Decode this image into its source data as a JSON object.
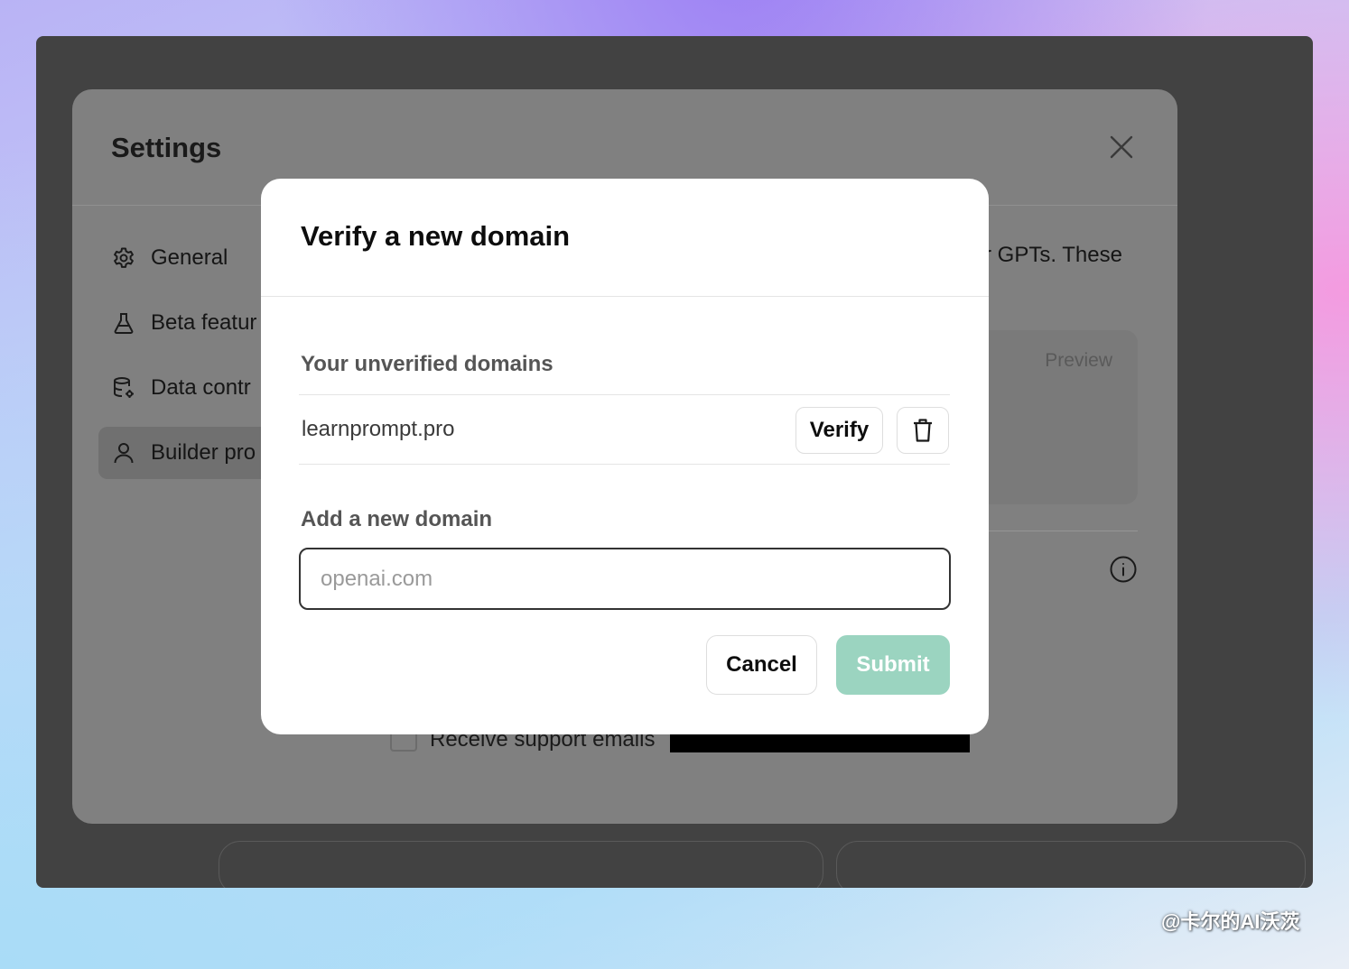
{
  "settings": {
    "title": "Settings",
    "nav": [
      {
        "label": "General",
        "icon": "gear-icon"
      },
      {
        "label": "Beta featur",
        "icon": "flask-icon"
      },
      {
        "label": "Data contr",
        "icon": "database-gear-icon"
      },
      {
        "label": "Builder pro",
        "icon": "user-icon",
        "active": true
      }
    ],
    "right_text": "r GPTs. These",
    "preview_label": "Preview",
    "support_label": "Receive support emails"
  },
  "modal": {
    "title": "Verify a new domain",
    "unverified_label": "Your unverified domains",
    "domains": [
      {
        "name": "learnprompt.pro",
        "verify_label": "Verify"
      }
    ],
    "new_domain_label": "Add a new domain",
    "input_placeholder": "openai.com",
    "cancel_label": "Cancel",
    "submit_label": "Submit"
  },
  "watermark": "@卡尔的AI沃茨",
  "colors": {
    "submit_disabled": "#9bd4c0",
    "overlay": "#424242",
    "settings_panel": "#808080"
  }
}
